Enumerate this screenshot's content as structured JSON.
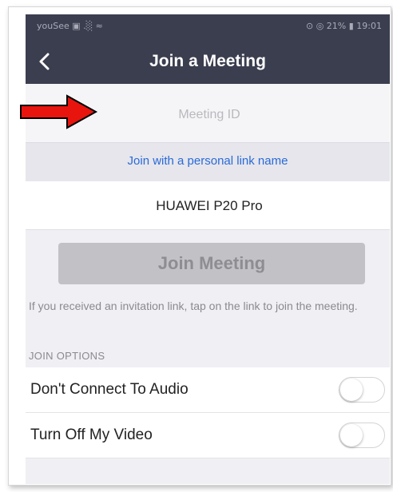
{
  "statusbar": {
    "left": "youSee ▣ .░ ≈",
    "right": "⊙ ◎ 21% ▮ 19:01"
  },
  "nav": {
    "title": "Join a Meeting"
  },
  "meeting_id": {
    "placeholder": "Meeting ID",
    "value": ""
  },
  "personal_link": {
    "label": "Join with a personal link name"
  },
  "name_field": {
    "value": "HUAWEI P20 Pro"
  },
  "join_button": {
    "label": "Join Meeting"
  },
  "hint": {
    "text": "If you received an invitation link, tap on the link to join the meeting."
  },
  "options": {
    "header": "JOIN OPTIONS",
    "items": [
      {
        "label": "Don't Connect To Audio",
        "enabled": false
      },
      {
        "label": "Turn Off My Video",
        "enabled": false
      }
    ]
  },
  "colors": {
    "nav_bg": "#3b3e4f",
    "link": "#2a6ad8",
    "join_disabled": "#c2c2c6",
    "annotation_arrow": "#e8140e"
  }
}
